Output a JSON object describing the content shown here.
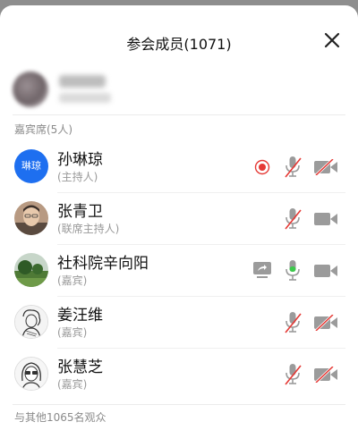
{
  "header": {
    "title": "参会成员(1071)"
  },
  "guest_section": {
    "label": "嘉宾席(5人)"
  },
  "members": [
    {
      "name": "孙琳琼",
      "role": "(主持人)",
      "avatar_text": "琳琼",
      "recording": true,
      "sharing": false,
      "mic": "muted",
      "camera": "off"
    },
    {
      "name": "张青卫",
      "role": "(联席主持人)",
      "recording": false,
      "sharing": false,
      "mic": "muted",
      "camera": "on"
    },
    {
      "name": "社科院辛向阳",
      "role": "(嘉宾)",
      "recording": false,
      "sharing": true,
      "mic": "active",
      "camera": "on"
    },
    {
      "name": "姜汪维",
      "role": "(嘉宾)",
      "recording": false,
      "sharing": false,
      "mic": "muted",
      "camera": "off"
    },
    {
      "name": "张慧芝",
      "role": "(嘉宾)",
      "recording": false,
      "sharing": false,
      "mic": "muted",
      "camera": "off"
    }
  ],
  "audience": {
    "label": "与其他1065名观众"
  },
  "colors": {
    "accent_blue": "#1e6ff0",
    "mute_red": "#e53935",
    "record_red": "#e53935",
    "mic_green": "#3cc94b",
    "icon_gray": "#9b9b9b"
  }
}
